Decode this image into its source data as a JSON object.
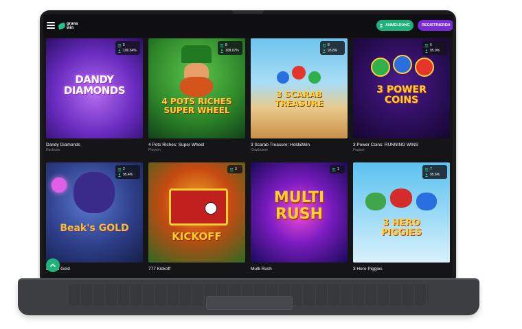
{
  "header": {
    "logo_text": "grana win",
    "login_label": "ANMELDUNG",
    "register_label": "REGISTRIEREN"
  },
  "games": [
    {
      "title": "Dandy Diamonds",
      "provider": "Hacksaw",
      "players": "5",
      "rtp": "106.54%",
      "art_text": "DANDY DIAMONDS"
    },
    {
      "title": "4 Pots Riches: Super Wheel",
      "provider": "Playson",
      "players": "8",
      "rtp": "108.07%",
      "art_text": "4 POTS RICHES SUPER WHEEL"
    },
    {
      "title": "3 Scarab Treasure: Hold&Win",
      "provider": "Clawbuster",
      "players": "8",
      "rtp": "93.8%",
      "art_text": "3 SCARAB TREASURE"
    },
    {
      "title": "3 Power Coins: RUNNING WINS",
      "provider": "Fugaso",
      "players": "6",
      "rtp": "95.9%",
      "art_text": "3 POWER COINS"
    },
    {
      "title": "Beak's Gold",
      "provider": "",
      "players": "2",
      "rtp": "95.4%",
      "art_text": "Beak's GOLD"
    },
    {
      "title": "777 Kickoff",
      "provider": "",
      "players": "3",
      "rtp": "",
      "art_text": "KICKOFF"
    },
    {
      "title": "Multi Rush",
      "provider": "",
      "players": "1",
      "rtp": "",
      "art_text": "MULTI RUSH"
    },
    {
      "title": "3 Hero Piggies",
      "provider": "",
      "players": "7",
      "rtp": "95.6%",
      "art_text": "3 HERO PIGGIES"
    }
  ],
  "colors": {
    "accent": "#1fb27d",
    "register": "#7a2bd6",
    "background": "#151518"
  },
  "icons": {
    "menu": "hamburger-icon",
    "players": "players-icon",
    "rtp": "rtp-icon",
    "scroll_top": "chevron-up-icon"
  }
}
